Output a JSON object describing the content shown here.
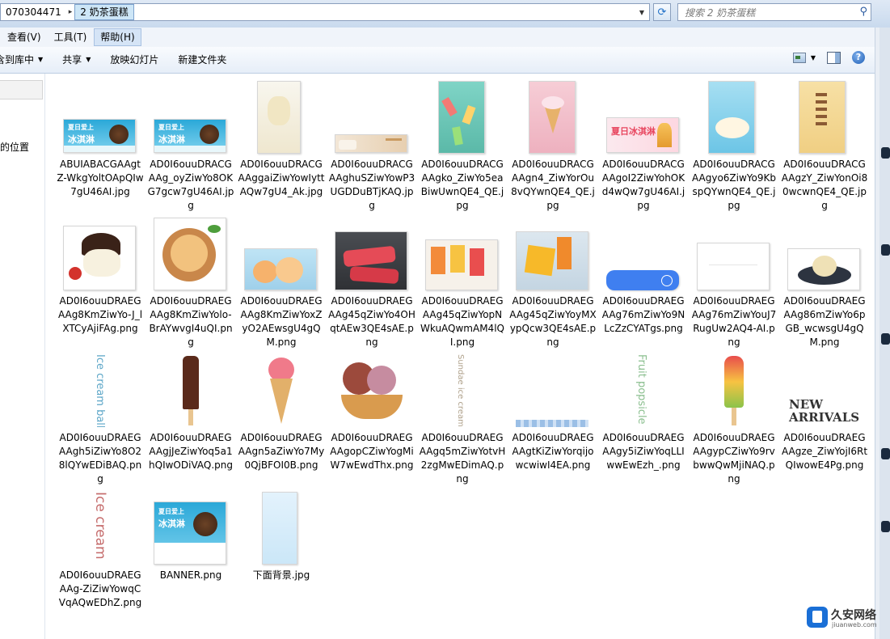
{
  "address_bar": {
    "segments": [
      "070304471",
      "2 奶茶蛋糕"
    ],
    "search_placeholder": "搜索 2 奶茶蛋糕"
  },
  "menu": {
    "items": [
      "查看(V)",
      "工具(T)",
      "帮助(H)"
    ]
  },
  "toolbar": {
    "include_library": "含到库中",
    "share": "共享",
    "slideshow": "放映幻灯片",
    "new_folder": "新建文件夹"
  },
  "nav_pane": {
    "item": "的位置"
  },
  "files": [
    {
      "name": "ABUIABACGAAgtZ-WkgYoltOApQIw7gU46AI.jpg"
    },
    {
      "name": "AD0I6ouuDRACGAAg_oyZiwYo8OKG7gcw7gU46AI.jpg"
    },
    {
      "name": "AD0I6ouuDRACGAAggaiZiwYowIyttAQw7gU4_Ak.jpg"
    },
    {
      "name": "AD0I6ouuDRACGAAghuSZiwYowP3UGDDuBTjKAQ.jpg"
    },
    {
      "name": "AD0I6ouuDRACGAAgko_ZiwYo5eaBiwUwnQE4_QE.jpg"
    },
    {
      "name": "AD0I6ouuDRACGAAgn4_ZiwYorOu8vQYwnQE4_QE.jpg"
    },
    {
      "name": "AD0I6ouuDRACGAAgoI2ZiwYohOKd4wQw7gU46AI.jpg"
    },
    {
      "name": "AD0I6ouuDRACGAAgyo6ZiwYo9KbspQYwnQE4_QE.jpg"
    },
    {
      "name": "AD0I6ouuDRACGAAgzY_ZiwYonOi80wcwnQE4_QE.jpg"
    },
    {
      "name": "AD0I6ouuDRAEGAAg8KmZiwYo-J_lXTCyAjiFAg.png"
    },
    {
      "name": "AD0I6ouuDRAEGAAg8KmZiwYolo-BrAYwvgI4uQI.png"
    },
    {
      "name": "AD0I6ouuDRAEGAAg8KmZiwYoxZyO2AEwsgU4gQM.png"
    },
    {
      "name": "AD0I6ouuDRAEGAAg45qZiwYo4OHqtAEw3QE4sAE.png"
    },
    {
      "name": "AD0I6ouuDRAEGAAg45qZiwYopNWkuAQwmAM4lQI.png"
    },
    {
      "name": "AD0I6ouuDRAEGAAg45qZiwYoyMXypQcw3QE4sAE.png"
    },
    {
      "name": "AD0I6ouuDRAEGAAg76mZiwYo9NLcZzCYATgs.png"
    },
    {
      "name": "AD0I6ouuDRAEGAAg76mZiwYouJ7RugUw2AQ4-AI.png"
    },
    {
      "name": "AD0I6ouuDRAEGAAg86mZiwYo6pGB_wcwsgU4gQM.png"
    },
    {
      "name": "AD0I6ouuDRAEGAAgh5iZiwYo8O28lQYwEDiBAQ.png"
    },
    {
      "name": "AD0I6ouuDRAEGAAgjJeZiwYoq5a1hQIwODiVAQ.png"
    },
    {
      "name": "AD0I6ouuDRAEGAAgn5aZiwYo7My0QjBFOI0B.png"
    },
    {
      "name": "AD0I6ouuDRAEGAAgopCZiwYogMiW7wEwdThx.png"
    },
    {
      "name": "AD0I6ouuDRAEGAAgq5mZiwYotvH2zgMwEDimAQ.png"
    },
    {
      "name": "AD0I6ouuDRAEGAAgtKiZiwYorqijowcwiwI4EA.png"
    },
    {
      "name": "AD0I6ouuDRAEGAAgy5iZiwYoqLLIwwEwEzh_.png"
    },
    {
      "name": "AD0I6ouuDRAEGAAgypCZiwYo9rvbwwQwMjiNAQ.png"
    },
    {
      "name": "AD0I6ouuDRAEGAAgze_ZiwYojI6RtQIwowE4Pg.png"
    },
    {
      "name": "AD0I6ouuDRAEGAAg-ZiZiwYowqCVqAQwEDhZ.png"
    },
    {
      "name": "BANNER.png"
    },
    {
      "name": "下面背景.jpg"
    }
  ],
  "thumb_texts": {
    "banner_line1": "夏日爱上",
    "banner_line2": "冰淇淋",
    "pink_banner": "夏日冰淇淋",
    "ice_cream_ball": "Ice cream ball",
    "sundae": "Sundae ice cream",
    "fruit_popsicle": "Fruit popsicle",
    "new_arrivals_1": "NEW",
    "new_arrivals_2": "ARRIVALS",
    "ice_cream": "Ice cream"
  },
  "watermark": {
    "name": "久安网络",
    "url": "jiuanweb.com"
  },
  "colors": {
    "selection": "#cde6f7",
    "toolbar": "#e6eef8",
    "accent_blue": "#3f7ff0"
  }
}
